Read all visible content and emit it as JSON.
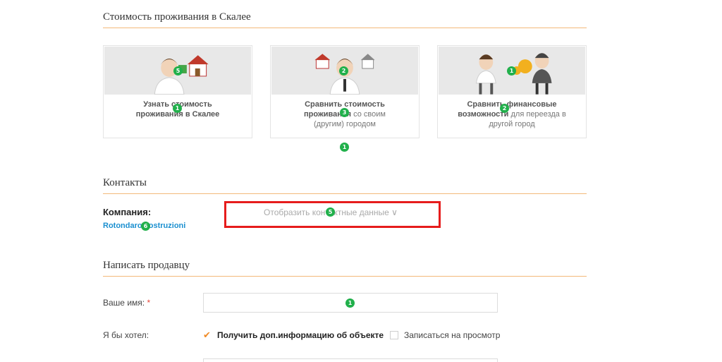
{
  "cost_section": {
    "title": "Стоимость проживания в Скалее",
    "cards": [
      {
        "line1_bold": "Узнать стоимость",
        "line2_bold": "проживания в Скалее",
        "line2_rest": "",
        "line3": ""
      },
      {
        "line1_bold": "Сравнить стоимость",
        "line2_bold": "проживания",
        "line2_rest": " со своим",
        "line3": "(другим) городом"
      },
      {
        "line1_bold": "Сравнить финансовые",
        "line2_bold": "возможности",
        "line2_rest": " для переезда в",
        "line3": "другой город"
      }
    ]
  },
  "contacts_section": {
    "title": "Контакты",
    "company_label": "Компания:",
    "company_name": "Rotondaro costruzioni",
    "show_contacts": "Отобразить контактные данные ∨"
  },
  "seller_section": {
    "title": "Написать продавцу",
    "name_label": "Ваше имя:",
    "required_mark": "*",
    "name_value": "",
    "want_label": "Я бы хотел:",
    "option_info": "Получить доп.информацию об объекте",
    "option_info_checked": true,
    "option_viewing": "Записаться на просмотр",
    "option_viewing_checked": false
  },
  "badges": [
    "5",
    "1",
    "2",
    "3",
    "1",
    "2",
    "1",
    "2",
    "1",
    "5",
    "6",
    "1"
  ],
  "colors": {
    "accent_rule": "#f3b97a",
    "link": "#1a8fd0",
    "badge": "#21b04b",
    "highlight": "#e61c1c",
    "check": "#f08a24"
  }
}
